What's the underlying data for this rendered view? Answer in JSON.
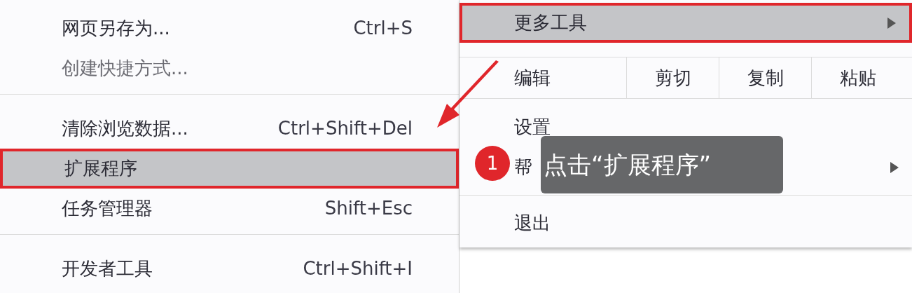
{
  "submenu": {
    "items": [
      {
        "kind": "item",
        "label": "网页另存为...",
        "shortcut": "Ctrl+S",
        "disabled": false,
        "selected": false
      },
      {
        "kind": "item",
        "label": "创建快捷方式...",
        "disabled": true,
        "selected": false
      },
      {
        "kind": "divider"
      },
      {
        "kind": "item",
        "label": "清除浏览数据...",
        "shortcut": "Ctrl+Shift+Del",
        "disabled": false,
        "selected": false
      },
      {
        "kind": "item",
        "label": "扩展程序",
        "disabled": false,
        "selected": true
      },
      {
        "kind": "item",
        "label": "任务管理器",
        "shortcut": "Shift+Esc",
        "disabled": false,
        "selected": false
      },
      {
        "kind": "divider"
      },
      {
        "kind": "item",
        "label": "开发者工具",
        "shortcut": "Ctrl+Shift+I",
        "disabled": false,
        "selected": false
      }
    ]
  },
  "menu": {
    "items": [
      {
        "kind": "item",
        "label": "更多工具",
        "submenu": true,
        "selected": true
      },
      {
        "kind": "edit",
        "label": "编辑",
        "actions": [
          "剪切",
          "复制",
          "粘贴"
        ]
      },
      {
        "kind": "item",
        "label": "设置",
        "submenu": false,
        "selected": false
      },
      {
        "kind": "item",
        "label": "帮",
        "submenu": true,
        "selected": false
      },
      {
        "kind": "divider"
      },
      {
        "kind": "item",
        "label": "退出",
        "submenu": false,
        "selected": false
      }
    ]
  },
  "annotation": {
    "step": "1",
    "text": "点击“扩展程序”"
  }
}
